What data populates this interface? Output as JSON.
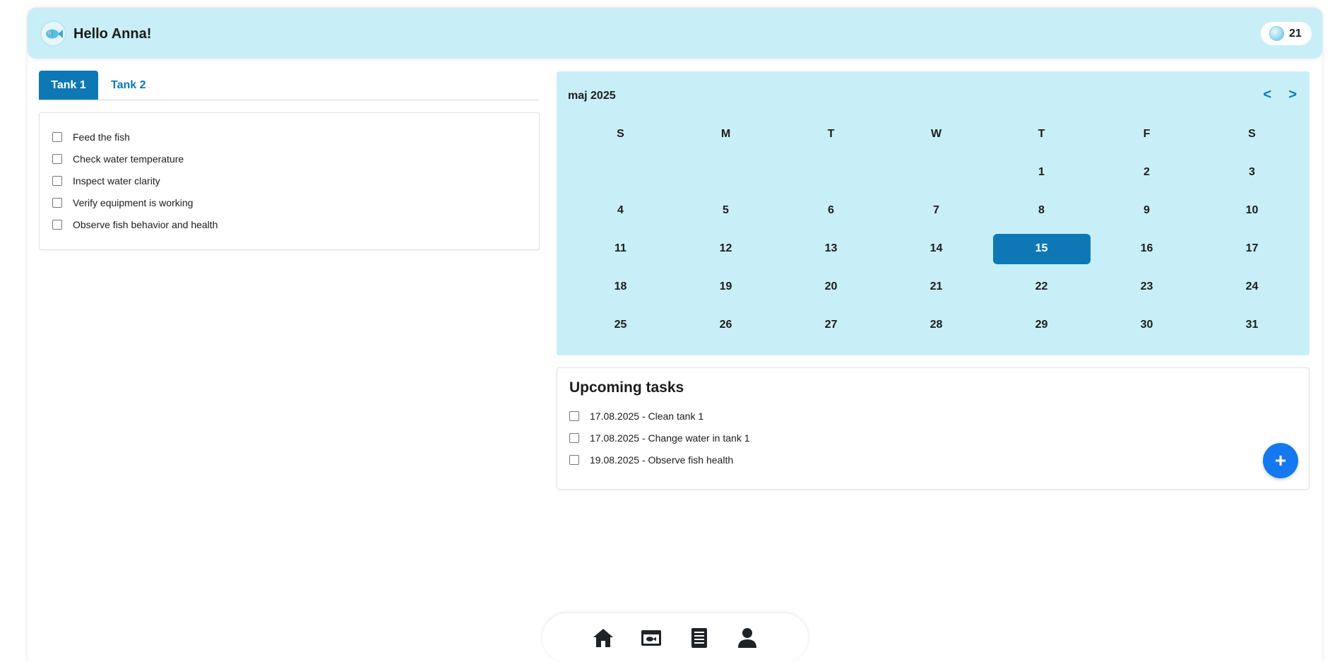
{
  "header": {
    "greeting": "Hello Anna!",
    "avatar_icon": "fish-icon",
    "bubble_count": "21",
    "bubble_icon": "bubble-icon"
  },
  "tabs": [
    {
      "label": "Tank 1",
      "active": true
    },
    {
      "label": "Tank 2",
      "active": false
    }
  ],
  "checklist": [
    {
      "label": "Feed the fish",
      "checked": false
    },
    {
      "label": "Check water temperature",
      "checked": false
    },
    {
      "label": "Inspect water clarity",
      "checked": false
    },
    {
      "label": "Verify equipment is working",
      "checked": false
    },
    {
      "label": "Observe fish behavior and health",
      "checked": false
    }
  ],
  "calendar": {
    "month_label": "maj 2025",
    "prev_label": "<",
    "next_label": ">",
    "weekdays": [
      "S",
      "M",
      "T",
      "W",
      "T",
      "F",
      "S"
    ],
    "weeks": [
      [
        "",
        "",
        "",
        "",
        "1",
        "2",
        "3"
      ],
      [
        "4",
        "5",
        "6",
        "7",
        "8",
        "9",
        "10"
      ],
      [
        "11",
        "12",
        "13",
        "14",
        "15",
        "16",
        "17"
      ],
      [
        "18",
        "19",
        "20",
        "21",
        "22",
        "23",
        "24"
      ],
      [
        "25",
        "26",
        "27",
        "28",
        "29",
        "30",
        "31"
      ]
    ],
    "selected_day": "15"
  },
  "upcoming": {
    "title": "Upcoming tasks",
    "tasks": [
      {
        "label": "17.08.2025 - Clean tank 1",
        "checked": false
      },
      {
        "label": "17.08.2025 - Change water in tank 1",
        "checked": false
      },
      {
        "label": "19.08.2025 - Observe fish health",
        "checked": false
      }
    ],
    "add_label": "+"
  },
  "bottom_nav": [
    {
      "name": "home",
      "icon": "home-icon"
    },
    {
      "name": "aquarium",
      "icon": "aquarium-icon"
    },
    {
      "name": "notes",
      "icon": "document-icon"
    },
    {
      "name": "profile",
      "icon": "user-icon"
    }
  ],
  "colors": {
    "header_bg": "#c8eff7",
    "accent": "#0d78b5",
    "add_button": "#1479f0"
  }
}
